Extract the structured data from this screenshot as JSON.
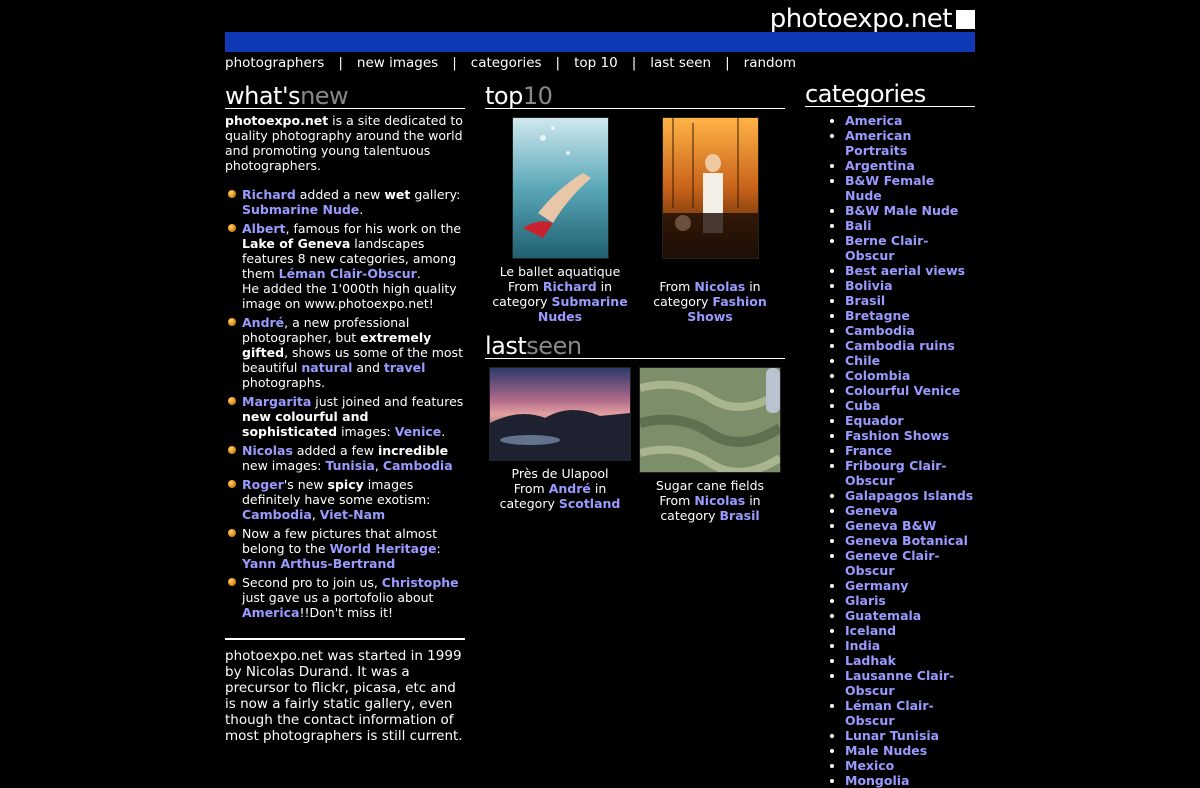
{
  "header": {
    "logo_text": "photoexpo.net",
    "bar_color": "#1039b8",
    "nav": [
      "photographers",
      "new images",
      "categories",
      "top 10",
      "last seen",
      "random"
    ],
    "nav_separator": "|"
  },
  "whats_new": {
    "title_a": "what's",
    "title_b": "new",
    "intro_bold": "photoexpo.net",
    "intro_rest": " is a site dedicated to quality photography around the world and promoting young talentuous photographers.",
    "items": [
      {
        "parts": [
          {
            "t": "link",
            "v": "Richard"
          },
          {
            "t": "text",
            "v": " added a new "
          },
          {
            "t": "bold",
            "v": "wet"
          },
          {
            "t": "text",
            "v": " gallery: "
          },
          {
            "t": "link",
            "v": "Submarine Nude"
          },
          {
            "t": "text",
            "v": "."
          }
        ]
      },
      {
        "parts": [
          {
            "t": "link",
            "v": "Albert"
          },
          {
            "t": "text",
            "v": ", famous for his work on the "
          },
          {
            "t": "bold",
            "v": "Lake of Geneva"
          },
          {
            "t": "text",
            "v": " landscapes features 8 new categories, among them "
          },
          {
            "t": "link",
            "v": "Léman Clair-Obscur"
          },
          {
            "t": "text",
            "v": ".\nHe added the 1'000th high quality image on www.photoexpo.net!"
          }
        ]
      },
      {
        "parts": [
          {
            "t": "link",
            "v": "André"
          },
          {
            "t": "text",
            "v": ", a new professional photographer, but "
          },
          {
            "t": "bold",
            "v": "extremely gifted"
          },
          {
            "t": "text",
            "v": ", shows us some of the most beautiful "
          },
          {
            "t": "link",
            "v": "natural"
          },
          {
            "t": "text",
            "v": " and "
          },
          {
            "t": "link",
            "v": "travel"
          },
          {
            "t": "text",
            "v": " photographs."
          }
        ]
      },
      {
        "parts": [
          {
            "t": "link",
            "v": "Margarita"
          },
          {
            "t": "text",
            "v": " just joined and features "
          },
          {
            "t": "bold",
            "v": "new colourful and sophisticated"
          },
          {
            "t": "text",
            "v": " images: "
          },
          {
            "t": "link",
            "v": "Venice"
          },
          {
            "t": "text",
            "v": "."
          }
        ]
      },
      {
        "parts": [
          {
            "t": "link",
            "v": "Nicolas"
          },
          {
            "t": "text",
            "v": " added a few "
          },
          {
            "t": "bold",
            "v": "incredible"
          },
          {
            "t": "text",
            "v": " new images: "
          },
          {
            "t": "link",
            "v": "Tunisia"
          },
          {
            "t": "text",
            "v": ", "
          },
          {
            "t": "link",
            "v": "Cambodia"
          }
        ]
      },
      {
        "parts": [
          {
            "t": "link",
            "v": "Roger"
          },
          {
            "t": "text",
            "v": "'s new "
          },
          {
            "t": "bold",
            "v": "spicy"
          },
          {
            "t": "text",
            "v": " images definitely have some exotism: "
          },
          {
            "t": "link",
            "v": "Cambodia"
          },
          {
            "t": "text",
            "v": ", "
          },
          {
            "t": "link",
            "v": "Viet-Nam"
          }
        ]
      },
      {
        "parts": [
          {
            "t": "text",
            "v": "Now a few pictures that almost belong to the "
          },
          {
            "t": "link",
            "v": "World Heritage"
          },
          {
            "t": "text",
            "v": ": "
          },
          {
            "t": "link",
            "v": "Yann Arthus-Bertrand"
          }
        ]
      },
      {
        "parts": [
          {
            "t": "text",
            "v": "Second pro to join us, "
          },
          {
            "t": "link",
            "v": "Christophe"
          },
          {
            "t": "text",
            "v": " just gave us a portofolio about "
          },
          {
            "t": "link",
            "v": "America"
          },
          {
            "t": "text",
            "v": "!!Don't miss it!"
          }
        ]
      }
    ],
    "about": "photoexpo.net was started in 1999 by Nicolas Durand. It was a precursor to flickr, picasa, etc and is now a fairly static gallery, even though the contact information of most photographers is still current."
  },
  "top10": {
    "title_a": "top",
    "title_b": "10",
    "items": [
      {
        "caption": "Le ballet aquatique",
        "from": "From ",
        "author": "Richard",
        "in": " in",
        "cat_prefix": "category ",
        "category": "Submarine Nudes",
        "image": "underwater-nude-photo"
      },
      {
        "caption": "",
        "from": "From ",
        "author": "Nicolas",
        "in": " in",
        "cat_prefix": "category ",
        "category": "Fashion Shows",
        "image": "fashion-harbor-photo"
      }
    ]
  },
  "last_seen": {
    "title_a": "last",
    "title_b": "seen",
    "items": [
      {
        "caption": "Près de Ulapool",
        "from": "From ",
        "author": "André",
        "in": " in",
        "cat_prefix": "category ",
        "category": "Scotland",
        "image": "sunset-lake-photo"
      },
      {
        "caption": "Sugar cane fields",
        "from": "From ",
        "author": "Nicolas",
        "in": " in",
        "cat_prefix": "category ",
        "category": "Brasil",
        "image": "aerial-fields-photo"
      }
    ]
  },
  "categories": {
    "title": "categories",
    "items": [
      "America",
      "American Portraits",
      "Argentina",
      "B&W Female Nude",
      "B&W Male Nude",
      "Bali",
      "Berne Clair-Obscur",
      "Best aerial views",
      "Bolivia",
      "Brasil",
      "Bretagne",
      "Cambodia",
      "Cambodia ruins",
      "Chile",
      "Colombia",
      "Colourful Venice",
      "Cuba",
      "Equador",
      "Fashion Shows",
      "France",
      "Fribourg Clair-Obscur",
      "Galapagos Islands",
      "Geneva",
      "Geneva B&W",
      "Geneva Botanical",
      "Geneve Clair-Obscur",
      "Germany",
      "Glaris",
      "Guatemala",
      "Iceland",
      "India",
      "Ladhak",
      "Lausanne Clair-Obscur",
      "Léman Clair-Obscur",
      "Lunar Tunisia",
      "Male Nudes",
      "Mexico",
      "Mongolia"
    ]
  },
  "colors": {
    "link": "#9a9aff",
    "background": "#000000",
    "text": "#ffffff",
    "bar": "#1039b8"
  }
}
